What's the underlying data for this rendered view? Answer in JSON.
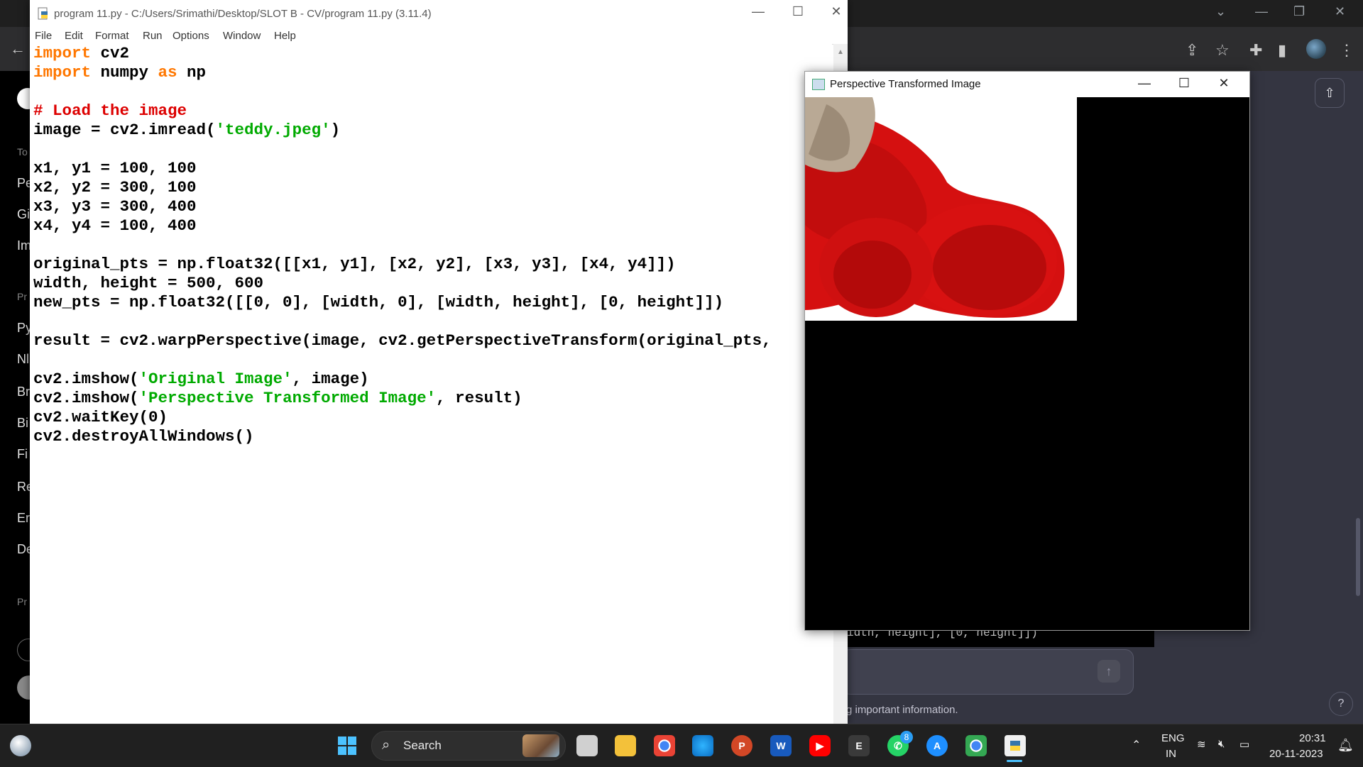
{
  "idle": {
    "title": "program 11.py - C:/Users/Srimathi/Desktop/SLOT B - CV/program 11.py (3.11.4)",
    "menu": [
      "File",
      "Edit",
      "Format",
      "Run",
      "Options",
      "Window",
      "Help"
    ],
    "code": [
      {
        "tokens": [
          {
            "t": "import",
            "c": "kw"
          },
          {
            "t": " cv2",
            "c": ""
          }
        ]
      },
      {
        "tokens": [
          {
            "t": "import",
            "c": "kw"
          },
          {
            "t": " numpy ",
            "c": ""
          },
          {
            "t": "as",
            "c": "kw"
          },
          {
            "t": " np",
            "c": ""
          }
        ]
      },
      {
        "tokens": []
      },
      {
        "tokens": [
          {
            "t": "# Load the image",
            "c": "cm"
          }
        ]
      },
      {
        "tokens": [
          {
            "t": "image = cv2.imread(",
            "c": ""
          },
          {
            "t": "'teddy.jpeg'",
            "c": "st"
          },
          {
            "t": ")",
            "c": ""
          }
        ]
      },
      {
        "tokens": []
      },
      {
        "tokens": [
          {
            "t": "x1, y1 = 100, 100",
            "c": ""
          }
        ]
      },
      {
        "tokens": [
          {
            "t": "x2, y2 = 300, 100",
            "c": ""
          }
        ]
      },
      {
        "tokens": [
          {
            "t": "x3, y3 = 300, 400",
            "c": ""
          }
        ]
      },
      {
        "tokens": [
          {
            "t": "x4, y4 = 100, 400",
            "c": ""
          }
        ]
      },
      {
        "tokens": []
      },
      {
        "tokens": [
          {
            "t": "original_pts = np.float32([[x1, y1], [x2, y2], [x3, y3], [x4, y4]])",
            "c": ""
          }
        ]
      },
      {
        "tokens": [
          {
            "t": "width, height = 500, 600",
            "c": ""
          }
        ]
      },
      {
        "tokens": [
          {
            "t": "new_pts = np.float32([[0, 0], [width, 0], [width, height], [0, height]])",
            "c": ""
          }
        ]
      },
      {
        "tokens": []
      },
      {
        "tokens": [
          {
            "t": "result = cv2.warpPerspective(image, cv2.getPerspectiveTransform(original_pts,",
            "c": ""
          }
        ]
      },
      {
        "tokens": []
      },
      {
        "tokens": [
          {
            "t": "cv2.imshow(",
            "c": ""
          },
          {
            "t": "'Original Image'",
            "c": "st"
          },
          {
            "t": ", image)",
            "c": ""
          }
        ]
      },
      {
        "tokens": [
          {
            "t": "cv2.imshow(",
            "c": ""
          },
          {
            "t": "'Perspective Transformed Image'",
            "c": "st"
          },
          {
            "t": ", result)",
            "c": ""
          }
        ]
      },
      {
        "tokens": [
          {
            "t": "cv2.waitKey(0)",
            "c": ""
          }
        ]
      },
      {
        "tokens": [
          {
            "t": "cv2.destroyAllWindows()",
            "c": ""
          }
        ]
      }
    ]
  },
  "cvwin": {
    "title": "Perspective Transformed Image"
  },
  "browser": {
    "rail_items": [
      "To",
      "Pe",
      "Gi",
      "Im",
      "Pr",
      "Py",
      "Nl",
      "Br",
      "Bi",
      "Fi",
      "Re",
      "Er",
      "De",
      "Pr"
    ],
    "code_strip": "idth, height], [0, height]])",
    "disclaimer": "g important information.",
    "help": "?"
  },
  "taskbar": {
    "search_label": "Search",
    "whatsapp_badge": "8",
    "lang_top": "ENG",
    "lang_bottom": "IN",
    "time": "20:31",
    "date": "20-11-2023",
    "app_letters": {
      "powerpoint": "P",
      "word": "W",
      "epic": "E"
    }
  },
  "colors": {
    "keyword": "#ff7700",
    "comment": "#dd0000",
    "string": "#00aa00",
    "teddy_red": "#d90f0f",
    "taskbar": "#202020"
  }
}
